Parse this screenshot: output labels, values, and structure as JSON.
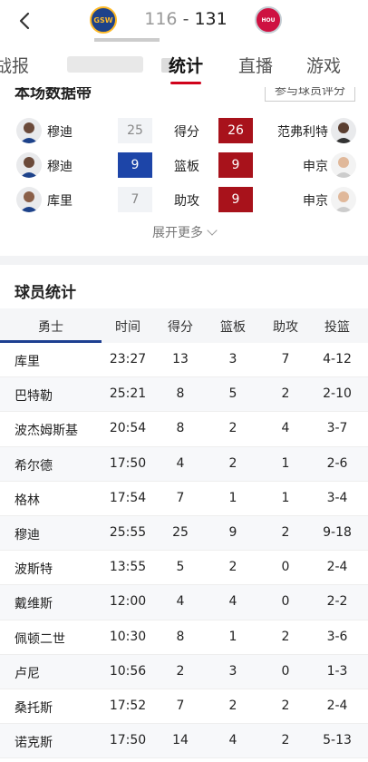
{
  "header": {
    "home_logo_text": "GSW",
    "away_logo_text": "HOU",
    "home_score": "116",
    "separator": "-",
    "away_score": "131"
  },
  "tabs": [
    {
      "label": "战报"
    },
    {
      "label": "统计",
      "active": true
    },
    {
      "label": "直播"
    },
    {
      "label": "游戏"
    }
  ],
  "summary": {
    "title": "本场数据带",
    "rate_button": "参与球员评分",
    "rows": [
      {
        "left_player": "穆迪",
        "left_value": "25",
        "label": "得分",
        "right_value": "26",
        "right_player": "范弗利特"
      },
      {
        "left_player": "穆迪",
        "left_value": "9",
        "label": "篮板",
        "right_value": "9",
        "right_player": "申京"
      },
      {
        "left_player": "库里",
        "left_value": "7",
        "label": "助攻",
        "right_value": "9",
        "right_player": "申京"
      }
    ],
    "expand_label": "展开更多"
  },
  "player_stats": {
    "title": "球员统计",
    "columns": [
      "勇士",
      "时间",
      "得分",
      "篮板",
      "助攻",
      "投篮"
    ],
    "rows": [
      [
        "库里",
        "23:27",
        "13",
        "3",
        "7",
        "4-12"
      ],
      [
        "巴特勒",
        "25:21",
        "8",
        "5",
        "2",
        "2-10"
      ],
      [
        "波杰姆斯基",
        "20:54",
        "8",
        "2",
        "4",
        "3-7"
      ],
      [
        "希尔德",
        "17:50",
        "4",
        "2",
        "1",
        "2-6"
      ],
      [
        "格林",
        "17:54",
        "7",
        "1",
        "1",
        "3-4"
      ],
      [
        "穆迪",
        "25:55",
        "25",
        "9",
        "2",
        "9-18"
      ],
      [
        "波斯特",
        "13:55",
        "5",
        "2",
        "0",
        "2-4"
      ],
      [
        "戴维斯",
        "12:00",
        "4",
        "4",
        "0",
        "2-2"
      ],
      [
        "佩顿二世",
        "10:30",
        "8",
        "1",
        "2",
        "3-6"
      ],
      [
        "卢尼",
        "10:56",
        "2",
        "3",
        "0",
        "1-3"
      ],
      [
        "桑托斯",
        "17:52",
        "7",
        "2",
        "2",
        "2-4"
      ],
      [
        "诺克斯",
        "17:50",
        "14",
        "4",
        "2",
        "5-13"
      ]
    ]
  },
  "colors": {
    "accent_red": "#d0021b",
    "warriors_blue": "#1d45a8",
    "rockets_red": "#a8121b"
  }
}
